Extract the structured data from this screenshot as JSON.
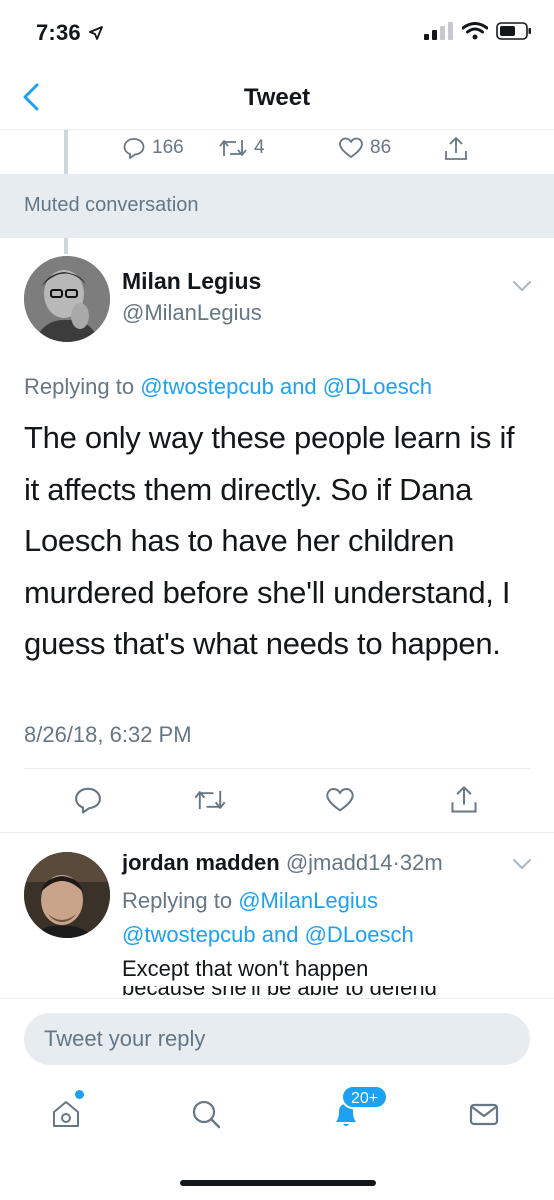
{
  "status_bar": {
    "time": "7:36"
  },
  "nav": {
    "title": "Tweet",
    "back_icon": "chevron-left-icon"
  },
  "parent_stats": {
    "replies": "166",
    "retweets": "4",
    "likes": "86"
  },
  "muted_banner": {
    "label": "Muted conversation"
  },
  "tweet": {
    "author_name": "Milan Legius",
    "author_handle": "@MilanLegius",
    "replying_prefix": "Replying to",
    "replying_to_1": "@twostepcub",
    "replying_and": "and",
    "replying_to_2": "@DLoesch",
    "text": "The only way these people learn is if it affects them directly. So if Dana Loesch has to have her children murdered before she'll understand, I guess that's what needs to happen.",
    "date": "8/26/18, 6:32 PM"
  },
  "reply": {
    "author_name": "jordan madden",
    "author_handle": "@jmadd14",
    "separator": "·",
    "time": "32m",
    "replying_prefix": "Replying to",
    "replying_to_1": "@MilanLegius",
    "replying_to_2": "@twostepcub",
    "replying_and": "and",
    "replying_to_3": "@DLoesch",
    "text": "Except that won't happen",
    "text_cut": "because she'll be able to defend"
  },
  "compose": {
    "placeholder": "Tweet your reply"
  },
  "tab_bar": {
    "notifications_badge": "20+"
  },
  "colors": {
    "accent": "#1da1f2",
    "secondary_text": "#657786",
    "divider": "#e6ecf0"
  }
}
